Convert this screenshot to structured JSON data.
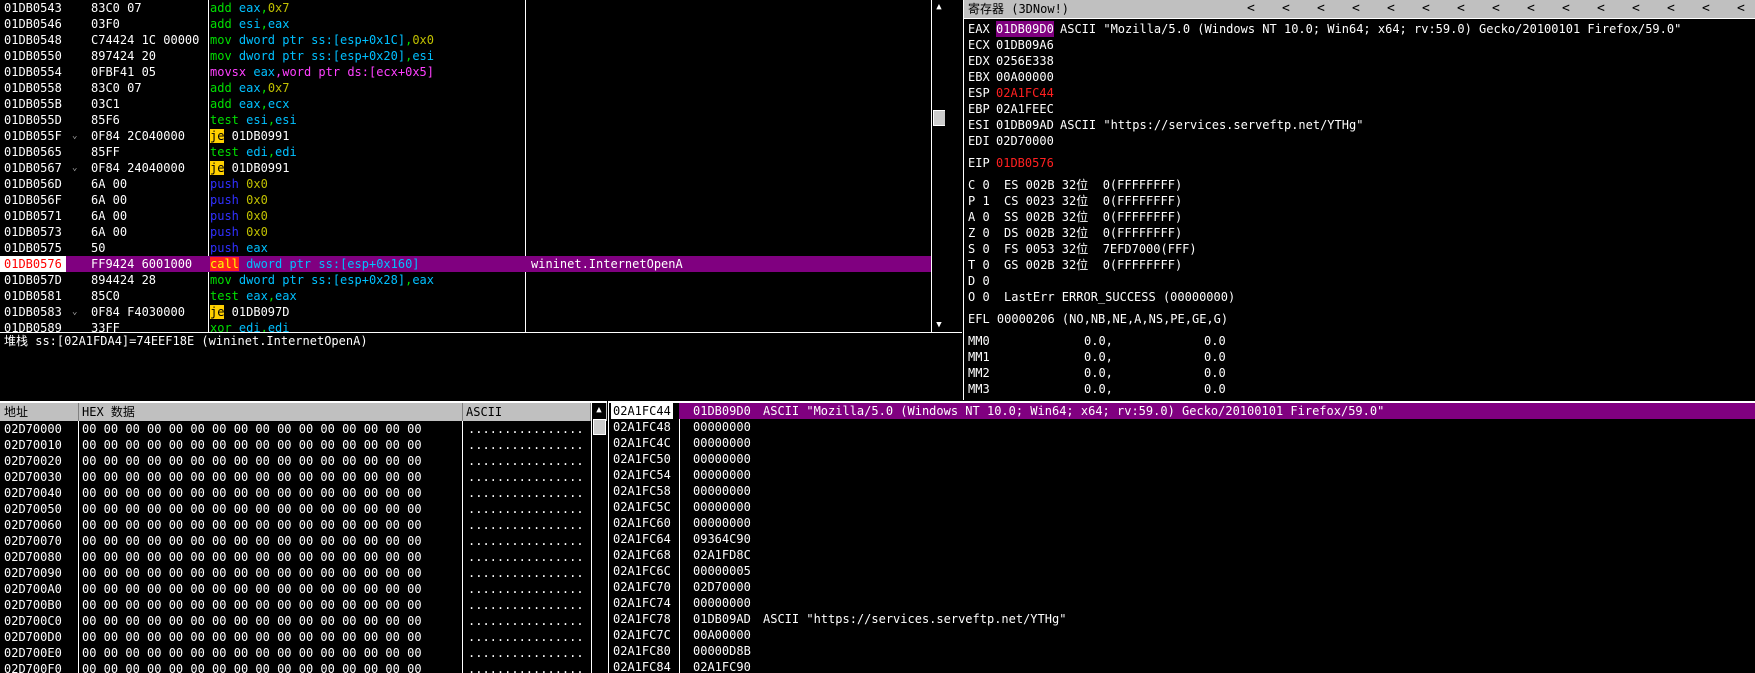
{
  "disasm": {
    "rows": [
      {
        "addr": "01DB0543",
        "hex": "83C0 07",
        "arrow": "",
        "parts": [
          {
            "t": "add ",
            "c": "green"
          },
          {
            "t": "eax",
            "c": "cyan"
          },
          {
            "t": ",",
            "c": "green"
          },
          {
            "t": "0x7",
            "c": "yel"
          }
        ],
        "comment": ""
      },
      {
        "addr": "01DB0546",
        "hex": "03F0",
        "arrow": "",
        "parts": [
          {
            "t": "add ",
            "c": "green"
          },
          {
            "t": "esi",
            "c": "cyan"
          },
          {
            "t": ",",
            "c": "green"
          },
          {
            "t": "eax",
            "c": "cyan"
          }
        ],
        "comment": ""
      },
      {
        "addr": "01DB0548",
        "hex": "C74424 1C 00000",
        "arrow": "",
        "parts": [
          {
            "t": "mov ",
            "c": "green"
          },
          {
            "t": "dword ptr ",
            "c": "cyan"
          },
          {
            "t": "ss:[esp+0x1C]",
            "c": "cyan"
          },
          {
            "t": ",",
            "c": "green"
          },
          {
            "t": "0x0",
            "c": "yel"
          }
        ],
        "comment": ""
      },
      {
        "addr": "01DB0550",
        "hex": "897424 20",
        "arrow": "",
        "parts": [
          {
            "t": "mov ",
            "c": "green"
          },
          {
            "t": "dword ptr ",
            "c": "cyan"
          },
          {
            "t": "ss:[esp+0x20]",
            "c": "cyan"
          },
          {
            "t": ",",
            "c": "green"
          },
          {
            "t": "esi",
            "c": "cyan"
          }
        ],
        "comment": ""
      },
      {
        "addr": "01DB0554",
        "hex": "0FBF41 05",
        "arrow": "",
        "parts": [
          {
            "t": "movsx ",
            "c": "mag"
          },
          {
            "t": "eax",
            "c": "cyan"
          },
          {
            "t": ",",
            "c": "mag"
          },
          {
            "t": "word ptr ",
            "c": "mag"
          },
          {
            "t": "ds:[ecx+0x5]",
            "c": "mag"
          }
        ],
        "comment": ""
      },
      {
        "addr": "01DB0558",
        "hex": "83C0 07",
        "arrow": "",
        "parts": [
          {
            "t": "add ",
            "c": "green"
          },
          {
            "t": "eax",
            "c": "cyan"
          },
          {
            "t": ",",
            "c": "green"
          },
          {
            "t": "0x7",
            "c": "yel"
          }
        ],
        "comment": ""
      },
      {
        "addr": "01DB055B",
        "hex": "03C1",
        "arrow": "",
        "parts": [
          {
            "t": "add ",
            "c": "green"
          },
          {
            "t": "eax",
            "c": "cyan"
          },
          {
            "t": ",",
            "c": "green"
          },
          {
            "t": "ecx",
            "c": "cyan"
          }
        ],
        "comment": ""
      },
      {
        "addr": "01DB055D",
        "hex": "85F6",
        "arrow": "",
        "parts": [
          {
            "t": "test ",
            "c": "green"
          },
          {
            "t": "esi",
            "c": "cyan"
          },
          {
            "t": ",",
            "c": "green"
          },
          {
            "t": "esi",
            "c": "cyan"
          }
        ],
        "comment": ""
      },
      {
        "addr": "01DB055F",
        "hex": "0F84 2C040000",
        "arrow": "⌄",
        "parts": [
          {
            "t": "je",
            "c": "jec"
          },
          {
            "t": " 01DB0991",
            "c": "white"
          }
        ],
        "comment": ""
      },
      {
        "addr": "01DB0565",
        "hex": "85FF",
        "arrow": "",
        "parts": [
          {
            "t": "test ",
            "c": "green"
          },
          {
            "t": "edi",
            "c": "cyan"
          },
          {
            "t": ",",
            "c": "green"
          },
          {
            "t": "edi",
            "c": "cyan"
          }
        ],
        "comment": ""
      },
      {
        "addr": "01DB0567",
        "hex": "0F84 24040000",
        "arrow": "⌄",
        "parts": [
          {
            "t": "je",
            "c": "jec"
          },
          {
            "t": " 01DB0991",
            "c": "white"
          }
        ],
        "comment": ""
      },
      {
        "addr": "01DB056D",
        "hex": "6A 00",
        "arrow": "",
        "parts": [
          {
            "t": "push ",
            "c": "blue"
          },
          {
            "t": "0x0",
            "c": "yel"
          }
        ],
        "comment": ""
      },
      {
        "addr": "01DB056F",
        "hex": "6A 00",
        "arrow": "",
        "parts": [
          {
            "t": "push ",
            "c": "blue"
          },
          {
            "t": "0x0",
            "c": "yel"
          }
        ],
        "comment": ""
      },
      {
        "addr": "01DB0571",
        "hex": "6A 00",
        "arrow": "",
        "parts": [
          {
            "t": "push ",
            "c": "blue"
          },
          {
            "t": "0x0",
            "c": "yel"
          }
        ],
        "comment": ""
      },
      {
        "addr": "01DB0573",
        "hex": "6A 00",
        "arrow": "",
        "parts": [
          {
            "t": "push ",
            "c": "blue"
          },
          {
            "t": "0x0",
            "c": "yel"
          }
        ],
        "comment": ""
      },
      {
        "addr": "01DB0575",
        "hex": "50",
        "arrow": "",
        "parts": [
          {
            "t": "push ",
            "c": "blue"
          },
          {
            "t": "eax",
            "c": "cyan"
          }
        ],
        "comment": ""
      },
      {
        "addr": "01DB0576",
        "hex": "FF9424 6001000",
        "arrow": "",
        "parts": [
          {
            "t": "call",
            "c": "callc"
          },
          {
            "t": " dword ptr ",
            "c": "cyan"
          },
          {
            "t": "ss:[esp+0x160]",
            "c": "cyan"
          }
        ],
        "comment": "wininet.InternetOpenA",
        "selected": true
      },
      {
        "addr": "01DB057D",
        "hex": "894424 28",
        "arrow": "",
        "parts": [
          {
            "t": "mov ",
            "c": "green"
          },
          {
            "t": "dword ptr ",
            "c": "cyan"
          },
          {
            "t": "ss:[esp+0x28]",
            "c": "cyan"
          },
          {
            "t": ",",
            "c": "green"
          },
          {
            "t": "eax",
            "c": "cyan"
          }
        ],
        "comment": ""
      },
      {
        "addr": "01DB0581",
        "hex": "85C0",
        "arrow": "",
        "parts": [
          {
            "t": "test ",
            "c": "green"
          },
          {
            "t": "eax",
            "c": "cyan"
          },
          {
            "t": ",",
            "c": "green"
          },
          {
            "t": "eax",
            "c": "cyan"
          }
        ],
        "comment": ""
      },
      {
        "addr": "01DB0583",
        "hex": "0F84 F4030000",
        "arrow": "⌄",
        "parts": [
          {
            "t": "je",
            "c": "jec"
          },
          {
            "t": " 01DB097D",
            "c": "white"
          }
        ],
        "comment": ""
      },
      {
        "addr": "01DB0589",
        "hex": "33FF",
        "arrow": "",
        "parts": [
          {
            "t": "xor ",
            "c": "green"
          },
          {
            "t": "edi",
            "c": "cyan"
          },
          {
            "t": ",",
            "c": "green"
          },
          {
            "t": "edi",
            "c": "cyan"
          }
        ],
        "comment": ""
      }
    ]
  },
  "info_line": "堆栈 ss:[02A1FDA4]=74EEF18E (wininet.InternetOpenA)",
  "registers": {
    "title": "寄存器 (3DNow!)",
    "arrows": [
      "<",
      "<",
      "<",
      "<",
      "<",
      "<",
      "<",
      "<",
      "<",
      "<",
      "<",
      "<",
      "<",
      "<",
      "<"
    ],
    "gp": [
      {
        "name": "EAX",
        "value": "01DB09D0",
        "note": "ASCII \"Mozilla/5.0 (Windows NT 10.0; Win64; x64; rv:59.0) Gecko/20100101 Firefox/59.0\"",
        "hl": true,
        "red": false
      },
      {
        "name": "ECX",
        "value": "01DB09A6",
        "note": "",
        "hl": false,
        "red": false
      },
      {
        "name": "EDX",
        "value": "0256E338",
        "note": "",
        "hl": false,
        "red": false
      },
      {
        "name": "EBX",
        "value": "00A00000",
        "note": "",
        "hl": false,
        "red": false
      },
      {
        "name": "ESP",
        "value": "02A1FC44",
        "note": "",
        "hl": false,
        "red": true
      },
      {
        "name": "EBP",
        "value": "02A1FEEC",
        "note": "",
        "hl": false,
        "red": false
      },
      {
        "name": "ESI",
        "value": "01DB09AD",
        "note": "ASCII \"https://services.serveftp.net/YTHg\"",
        "hl": false,
        "red": false
      },
      {
        "name": "EDI",
        "value": "02D70000",
        "note": "",
        "hl": false,
        "red": false
      }
    ],
    "eip": {
      "name": "EIP",
      "value": "01DB0576"
    },
    "flags": [
      {
        "f": "C 0",
        "seg": "ES 002B 32位  0(FFFFFFFF)"
      },
      {
        "f": "P 1",
        "seg": "CS 0023 32位  0(FFFFFFFF)"
      },
      {
        "f": "A 0",
        "seg": "SS 002B 32位  0(FFFFFFFF)"
      },
      {
        "f": "Z 0",
        "seg": "DS 002B 32位  0(FFFFFFFF)"
      },
      {
        "f": "S 0",
        "seg": "FS 0053 32位  7EFD7000(FFF)"
      },
      {
        "f": "T 0",
        "seg": "GS 002B 32位  0(FFFFFFFF)"
      },
      {
        "f": "D 0",
        "seg": ""
      },
      {
        "f": "O 0",
        "seg": "LastErr ERROR_SUCCESS (00000000)"
      }
    ],
    "efl": "EFL 00000206 (NO,NB,NE,A,NS,PE,GE,G)",
    "mm": [
      {
        "n": "MM0",
        "a": "0.0,",
        "b": "0.0"
      },
      {
        "n": "MM1",
        "a": "0.0,",
        "b": "0.0"
      },
      {
        "n": "MM2",
        "a": "0.0,",
        "b": "0.0"
      },
      {
        "n": "MM3",
        "a": "0.0,",
        "b": "0.0"
      }
    ]
  },
  "dump": {
    "col_addr": "地址",
    "col_hex": "HEX 数据",
    "col_ascii": "ASCII",
    "rows": [
      {
        "a": "02D70000",
        "h": "00 00 00 00 00 00 00 00 00 00 00 00 00 00 00 00",
        "s": "................"
      },
      {
        "a": "02D70010",
        "h": "00 00 00 00 00 00 00 00 00 00 00 00 00 00 00 00",
        "s": "................"
      },
      {
        "a": "02D70020",
        "h": "00 00 00 00 00 00 00 00 00 00 00 00 00 00 00 00",
        "s": "................"
      },
      {
        "a": "02D70030",
        "h": "00 00 00 00 00 00 00 00 00 00 00 00 00 00 00 00",
        "s": "................"
      },
      {
        "a": "02D70040",
        "h": "00 00 00 00 00 00 00 00 00 00 00 00 00 00 00 00",
        "s": "................"
      },
      {
        "a": "02D70050",
        "h": "00 00 00 00 00 00 00 00 00 00 00 00 00 00 00 00",
        "s": "................"
      },
      {
        "a": "02D70060",
        "h": "00 00 00 00 00 00 00 00 00 00 00 00 00 00 00 00",
        "s": "................"
      },
      {
        "a": "02D70070",
        "h": "00 00 00 00 00 00 00 00 00 00 00 00 00 00 00 00",
        "s": "................"
      },
      {
        "a": "02D70080",
        "h": "00 00 00 00 00 00 00 00 00 00 00 00 00 00 00 00",
        "s": "................"
      },
      {
        "a": "02D70090",
        "h": "00 00 00 00 00 00 00 00 00 00 00 00 00 00 00 00",
        "s": "................"
      },
      {
        "a": "02D700A0",
        "h": "00 00 00 00 00 00 00 00 00 00 00 00 00 00 00 00",
        "s": "................"
      },
      {
        "a": "02D700B0",
        "h": "00 00 00 00 00 00 00 00 00 00 00 00 00 00 00 00",
        "s": "................"
      },
      {
        "a": "02D700C0",
        "h": "00 00 00 00 00 00 00 00 00 00 00 00 00 00 00 00",
        "s": "................"
      },
      {
        "a": "02D700D0",
        "h": "00 00 00 00 00 00 00 00 00 00 00 00 00 00 00 00",
        "s": "................"
      },
      {
        "a": "02D700E0",
        "h": "00 00 00 00 00 00 00 00 00 00 00 00 00 00 00 00",
        "s": "................"
      },
      {
        "a": "02D700F0",
        "h": "00 00 00 00 00 00 00 00 00 00 00 00 00 00 00 00",
        "s": "................"
      }
    ]
  },
  "stack": {
    "rows": [
      {
        "a": "02A1FC44",
        "v": "01DB09D0",
        "c": "ASCII \"Mozilla/5.0 (Windows NT 10.0; Win64; x64; rv:59.0) Gecko/20100101 Firefox/59.0\"",
        "sel": true
      },
      {
        "a": "02A1FC48",
        "v": "00000000",
        "c": ""
      },
      {
        "a": "02A1FC4C",
        "v": "00000000",
        "c": ""
      },
      {
        "a": "02A1FC50",
        "v": "00000000",
        "c": ""
      },
      {
        "a": "02A1FC54",
        "v": "00000000",
        "c": ""
      },
      {
        "a": "02A1FC58",
        "v": "00000000",
        "c": ""
      },
      {
        "a": "02A1FC5C",
        "v": "00000000",
        "c": ""
      },
      {
        "a": "02A1FC60",
        "v": "00000000",
        "c": ""
      },
      {
        "a": "02A1FC64",
        "v": "09364C90",
        "c": ""
      },
      {
        "a": "02A1FC68",
        "v": "02A1FD8C",
        "c": ""
      },
      {
        "a": "02A1FC6C",
        "v": "00000005",
        "c": ""
      },
      {
        "a": "02A1FC70",
        "v": "02D70000",
        "c": ""
      },
      {
        "a": "02A1FC74",
        "v": "00000000",
        "c": ""
      },
      {
        "a": "02A1FC78",
        "v": "01DB09AD",
        "c": "ASCII \"https://services.serveftp.net/YTHg\""
      },
      {
        "a": "02A1FC7C",
        "v": "00A00000",
        "c": ""
      },
      {
        "a": "02A1FC80",
        "v": "00000D8B",
        "c": ""
      },
      {
        "a": "02A1FC84",
        "v": "02A1FC90",
        "c": ""
      }
    ]
  }
}
